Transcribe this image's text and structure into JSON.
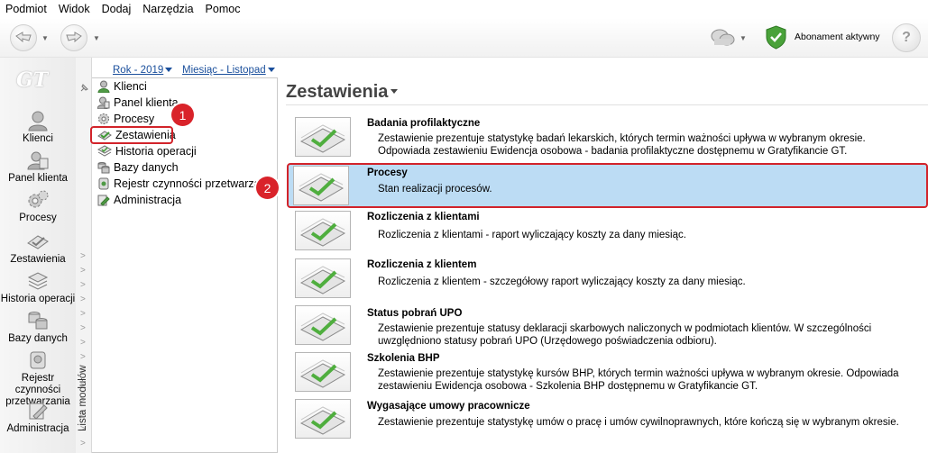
{
  "menu": [
    "Podmiot",
    "Widok",
    "Dodaj",
    "Narzędzia",
    "Pomoc"
  ],
  "toolbar": {
    "subscription_label": "Abonament aktywny"
  },
  "sidebar": {
    "logo": "GT",
    "items": [
      {
        "label": "Klienci",
        "icon": "person-icon"
      },
      {
        "label": "Panel klienta",
        "icon": "client-panel-icon"
      },
      {
        "label": "Procesy",
        "icon": "gears-icon"
      },
      {
        "label": "Zestawienia",
        "icon": "report-check-icon"
      },
      {
        "label": "Historia operacji",
        "icon": "history-icon"
      },
      {
        "label": "Bazy danych",
        "icon": "database-icon"
      },
      {
        "label": "Rejestr czynności przetwarzania",
        "icon": "register-icon"
      },
      {
        "label": "Administracja",
        "icon": "admin-icon"
      }
    ]
  },
  "strip": {
    "label": "Lista modułów"
  },
  "filters": {
    "year": "Rok - 2019",
    "month": "Miesiąc - Listopad"
  },
  "tree": {
    "items": [
      {
        "label": "Klienci",
        "icon": "person-icon"
      },
      {
        "label": "Panel klienta",
        "icon": "client-panel-icon"
      },
      {
        "label": "Procesy",
        "icon": "gear-icon"
      },
      {
        "label": "Zestawienia",
        "icon": "report-check-icon"
      },
      {
        "label": "Historia operacji",
        "icon": "history-icon"
      },
      {
        "label": "Bazy danych",
        "icon": "database-icon"
      },
      {
        "label": "Rejestr czynności przetwarzania",
        "icon": "register-icon"
      },
      {
        "label": "Administracja",
        "icon": "admin-icon"
      }
    ],
    "selected": "Zestawienia"
  },
  "badges": {
    "first": "1",
    "second": "2"
  },
  "main": {
    "title": "Zestawienia",
    "reports": [
      {
        "title": "Badania profilaktyczne",
        "desc": "Zestawienie prezentuje statystykę badań lekarskich, których termin ważności upływa w wybranym okresie. Odpowiada zestawieniu Ewidencja osobowa - badania profilaktyczne dostępnemu w Gratyfikancie GT."
      },
      {
        "title": "Procesy",
        "desc": "Stan realizacji procesów."
      },
      {
        "title": "Rozliczenia z klientami",
        "desc": "Rozliczenia z klientami - raport wyliczający koszty za dany miesiąc."
      },
      {
        "title": "Rozliczenia z klientem",
        "desc": "Rozliczenia z klientem - szczegółowy raport wyliczający koszty za dany miesiąc."
      },
      {
        "title": "Status pobrań UPO",
        "desc": "Zestawienie prezentuje statusy deklaracji skarbowych naliczonych w podmiotach klientów. W szczególności uwzględniono statusy pobrań UPO (Urzędowego poświadczenia odbioru)."
      },
      {
        "title": "Szkolenia BHP",
        "desc": "Zestawienie prezentuje statystykę kursów BHP, których termin ważności upływa w wybranym okresie. Odpowiada zestawieniu Ewidencja osobowa - Szkolenia BHP dostępnemu w Gratyfikancie GT."
      },
      {
        "title": "Wygasające umowy pracownicze",
        "desc": "Zestawienie prezentuje statystykę umów o pracę i umów cywilnoprawnych, które kończą się w wybranym okresie."
      }
    ],
    "selected": "Procesy"
  },
  "colors": {
    "accent": "#d2232a",
    "selection": "#bcdcf4",
    "link": "#1a4f9c"
  }
}
